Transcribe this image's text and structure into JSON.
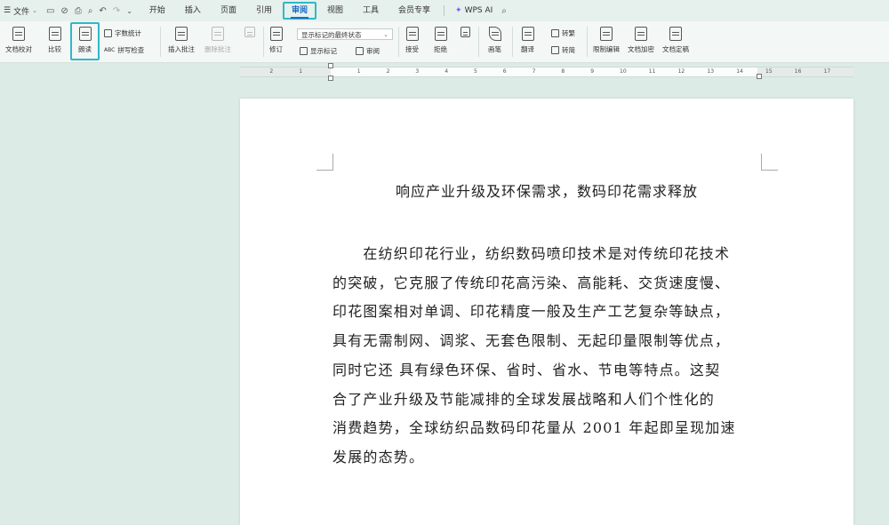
{
  "menubar": {
    "file_label": "文件",
    "tabs": [
      {
        "label": "开始"
      },
      {
        "label": "插入"
      },
      {
        "label": "页面"
      },
      {
        "label": "引用"
      },
      {
        "label": "审阅"
      },
      {
        "label": "视图"
      },
      {
        "label": "工具"
      },
      {
        "label": "会员专享"
      }
    ],
    "active_tab": "审阅",
    "wps_ai": "WPS AI"
  },
  "ribbon": {
    "doc_proof": "文档校对",
    "compare": "比较",
    "read_aloud": "朗读",
    "word_count": "字数统计",
    "spell_check": "拼写检查",
    "insert_comment": "插入批注",
    "delete_comment": "删除批注",
    "revise": "修订",
    "show_markup_state": "显示标记的最终状态",
    "show_markup": "显示标记",
    "review": "审阅",
    "accept": "接受",
    "reject": "拒绝",
    "pen": "画笔",
    "translate": "翻译",
    "to_traditional": "转繁",
    "to_simplified": "转简",
    "restrict_edit": "限制编辑",
    "doc_encrypt": "文档加密",
    "doc_finalize": "文档定稿"
  },
  "ruler": {
    "ticks": [
      "2",
      "1",
      "1",
      "2",
      "3",
      "4",
      "5",
      "6",
      "7",
      "8",
      "9",
      "10",
      "11",
      "12",
      "13",
      "14",
      "15",
      "16",
      "17"
    ]
  },
  "document": {
    "title": "响应产业升级及环保需求，数码印花需求释放",
    "lines": [
      "　　在纺织印花行业，纺织数码喷印技术是对传统印花技术",
      "的突破，它克服了传统印花高污染、高能耗、交货速度慢、",
      "印花图案相对单调、印花精度一般及生产工艺复杂等缺点，",
      "具有无需制网、调浆、无套色限制、无起印量限制等优点，",
      "同时它还 具有绿色环保、省时、省水、节电等特点。这契",
      "合了产业升级及节能减排的全球发展战略和人们个性化的",
      "消费趋势，全球纺织品数码印花量从 2001 年起即呈现加速",
      "发展的态势。"
    ]
  },
  "colors": {
    "background": "#dcebe6",
    "accent": "#1a6bc6",
    "highlight": "#2fb8c9"
  }
}
